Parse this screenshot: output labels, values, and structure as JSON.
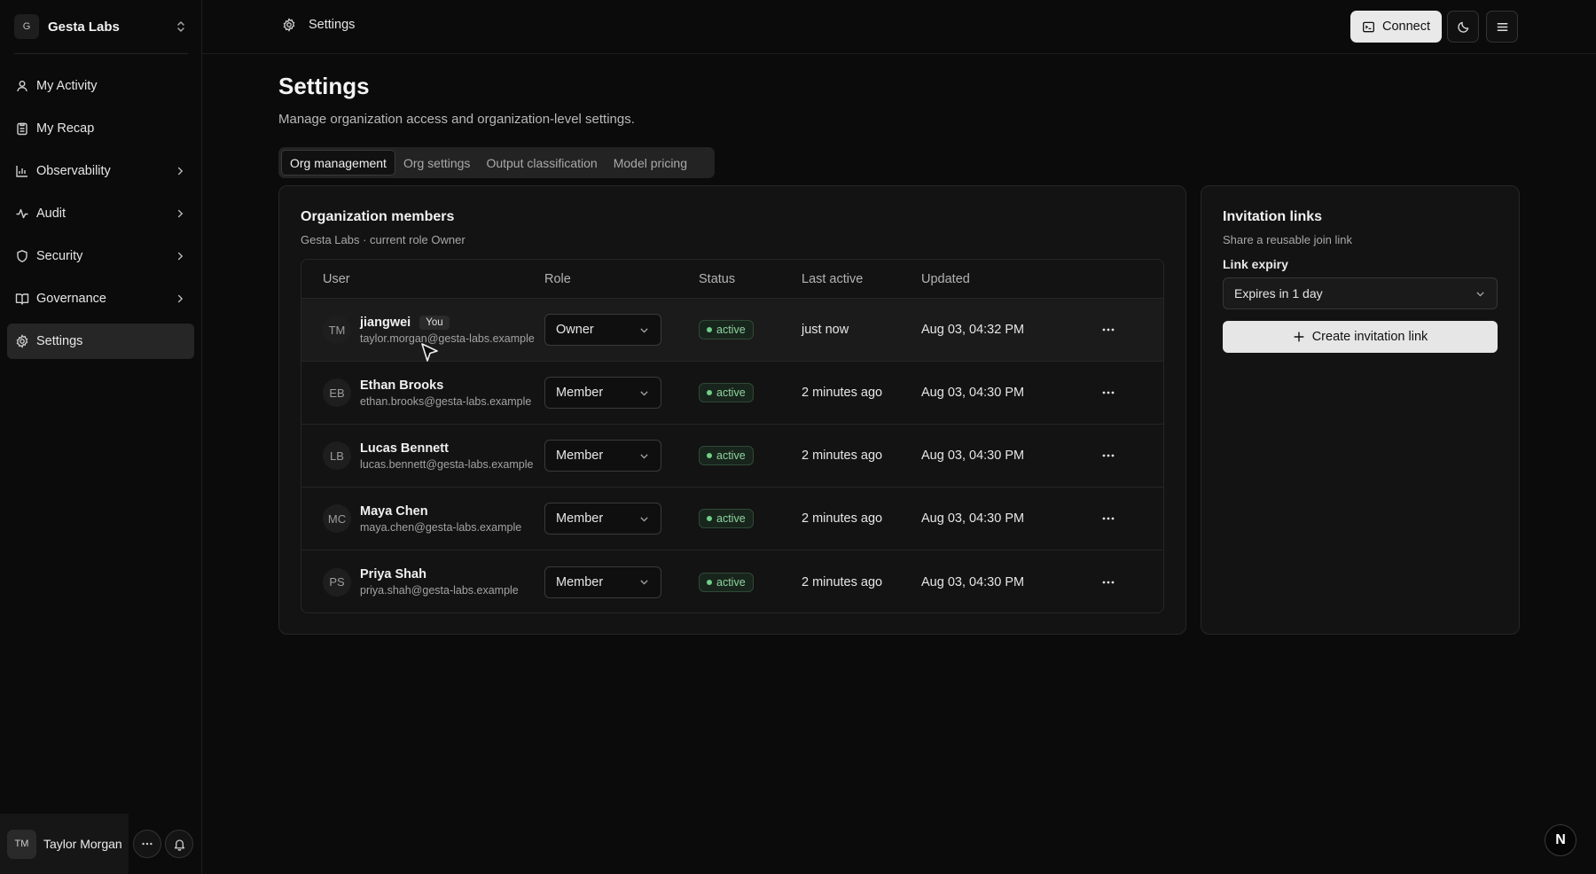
{
  "org": {
    "badge": "G",
    "name": "Gesta Labs"
  },
  "sidebar": {
    "items": [
      {
        "label": "My Activity",
        "icon": "user-icon",
        "has_chevron": false
      },
      {
        "label": "My Recap",
        "icon": "clipboard-icon",
        "has_chevron": false
      },
      {
        "label": "Observability",
        "icon": "bar-chart-icon",
        "has_chevron": true
      },
      {
        "label": "Audit",
        "icon": "activity-icon",
        "has_chevron": true
      },
      {
        "label": "Security",
        "icon": "shield-icon",
        "has_chevron": true
      },
      {
        "label": "Governance",
        "icon": "book-icon",
        "has_chevron": true
      },
      {
        "label": "Settings",
        "icon": "gear-icon",
        "has_chevron": false,
        "active": true
      }
    ]
  },
  "user": {
    "initials": "TM",
    "name": "Taylor Morgan"
  },
  "topbar": {
    "breadcrumb": "Settings",
    "connect_label": "Connect"
  },
  "page": {
    "title": "Settings",
    "subtitle": "Manage organization access and organization-level settings.",
    "tabs": [
      {
        "label": "Org management",
        "active": true
      },
      {
        "label": "Org settings"
      },
      {
        "label": "Output classification"
      },
      {
        "label": "Model pricing"
      }
    ]
  },
  "members": {
    "title": "Organization members",
    "subtitle": "Gesta Labs · current role Owner",
    "columns": [
      "User",
      "Role",
      "Status",
      "Last active",
      "Updated"
    ],
    "rows": [
      {
        "initials": "TM",
        "name": "jiangwei",
        "you": "You",
        "email": "taylor.morgan@gesta-labs.example",
        "role": "Owner",
        "status": "active",
        "last_active": "just now",
        "updated": "Aug 03, 04:32 PM"
      },
      {
        "initials": "EB",
        "name": "Ethan Brooks",
        "email": "ethan.brooks@gesta-labs.example",
        "role": "Member",
        "status": "active",
        "last_active": "2 minutes ago",
        "updated": "Aug 03, 04:30 PM"
      },
      {
        "initials": "LB",
        "name": "Lucas Bennett",
        "email": "lucas.bennett@gesta-labs.example",
        "role": "Member",
        "status": "active",
        "last_active": "2 minutes ago",
        "updated": "Aug 03, 04:30 PM"
      },
      {
        "initials": "MC",
        "name": "Maya Chen",
        "email": "maya.chen@gesta-labs.example",
        "role": "Member",
        "status": "active",
        "last_active": "2 minutes ago",
        "updated": "Aug 03, 04:30 PM"
      },
      {
        "initials": "PS",
        "name": "Priya Shah",
        "email": "priya.shah@gesta-labs.example",
        "role": "Member",
        "status": "active",
        "last_active": "2 minutes ago",
        "updated": "Aug 03, 04:30 PM"
      }
    ]
  },
  "invitations": {
    "title": "Invitation links",
    "subtitle": "Share a reusable join link",
    "expiry_label": "Link expiry",
    "expiry_value": "Expires in 1 day",
    "create_label": "Create invitation link"
  },
  "badge_letter": "N",
  "colors": {
    "background": "#0b0b0b",
    "card": "#131313",
    "status_green": "#8fd49f",
    "button_light": "#e9e9e9"
  }
}
